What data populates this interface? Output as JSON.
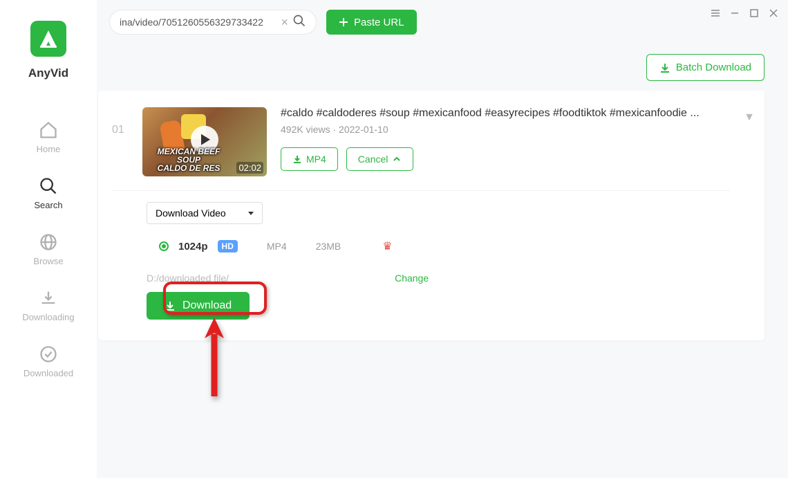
{
  "app_name": "AnyVid",
  "nav": {
    "home": "Home",
    "search": "Search",
    "browse": "Browse",
    "downloading": "Downloading",
    "downloaded": "Downloaded"
  },
  "search_value": "ina/video/7051260556329733422",
  "paste_url_label": "Paste URL",
  "batch_download_label": "Batch Download",
  "video": {
    "index": "01",
    "duration": "02:02",
    "thumb_caption": "MEXICAN BEEF SOUP\nCALDO DE RES",
    "title": "#caldo #caldoderes #soup #mexicanfood #easyrecipes #foodtiktok #mexicanfoodie ...",
    "views": "492K views",
    "date": "2022-01-10",
    "mp4_label": "MP4",
    "cancel_label": "Cancel"
  },
  "download_video_label": "Download Video",
  "quality": {
    "resolution": "1024p",
    "hd": "HD",
    "format": "MP4",
    "size": "23MB"
  },
  "path": "D:/downloaded file/",
  "change_label": "Change",
  "download_label": "Download"
}
